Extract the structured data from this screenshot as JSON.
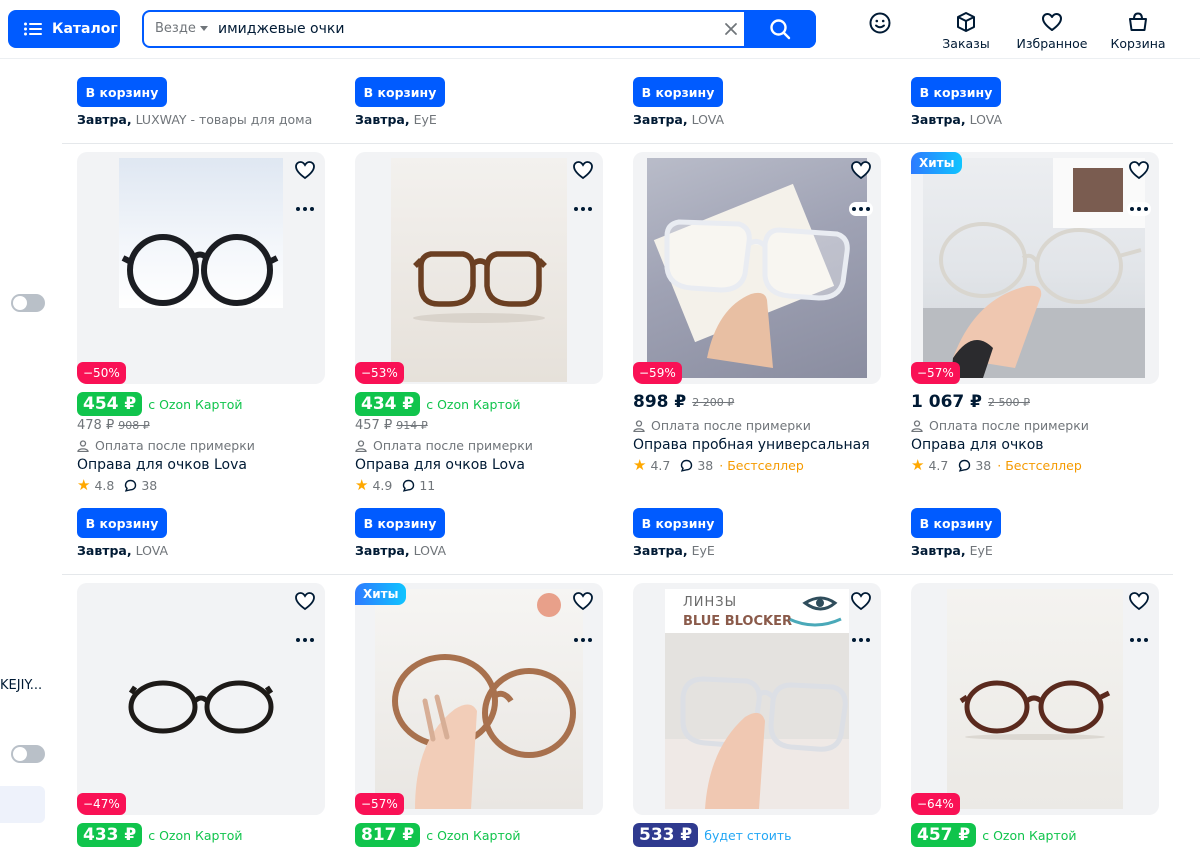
{
  "header": {
    "catalog_label": "Каталог",
    "search_scope": "Везде",
    "search_query": "имиджевые очки",
    "orders_label": "Заказы",
    "favorites_label": "Избранное",
    "cart_label": "Корзина"
  },
  "sidebar": {
    "truncated_text": "KEJIY..."
  },
  "top_row": [
    {
      "cart": "В корзину",
      "day": "Завтра,",
      "seller": "LUXWAY - товары для дома"
    },
    {
      "cart": "В корзину",
      "day": "Завтра,",
      "seller": "EyE"
    },
    {
      "cart": "В корзину",
      "day": "Завтра,",
      "seller": "LOVA"
    },
    {
      "cart": "В корзину",
      "day": "Завтра,",
      "seller": "LOVA"
    }
  ],
  "row2": [
    {
      "badge": "",
      "discount": "−50%",
      "price": "454 ₽",
      "price_note": "c Ozon Картой",
      "sub_price": "478 ₽",
      "old_price": "908 ₽",
      "pay": "Оплата после примерки",
      "title": "Оправа для очков Lova",
      "rating": "4.8",
      "reviews": "38",
      "best": "",
      "cart": "В корзину",
      "day": "Завтра,",
      "seller": "LOVA"
    },
    {
      "badge": "",
      "discount": "−53%",
      "price": "434 ₽",
      "price_note": "c Ozon Картой",
      "sub_price": "457 ₽",
      "old_price": "914 ₽",
      "pay": "Оплата после примерки",
      "title": "Оправа для очков Lova",
      "rating": "4.9",
      "reviews": "11",
      "best": "",
      "cart": "В корзину",
      "day": "Завтра,",
      "seller": "LOVA"
    },
    {
      "badge": "",
      "discount": "−59%",
      "price": "898 ₽",
      "price_note": "",
      "sub_price": "",
      "old_price": "2 200 ₽",
      "pay": "Оплата после примерки",
      "title": "Оправа пробная универсальная",
      "rating": "4.7",
      "reviews": "38",
      "best": "Бестселлер",
      "cart": "В корзину",
      "day": "Завтра,",
      "seller": "EyE"
    },
    {
      "badge": "Хиты",
      "discount": "−57%",
      "price": "1 067 ₽",
      "price_note": "",
      "sub_price": "",
      "old_price": "2 500 ₽",
      "pay": "Оплата после примерки",
      "title": "Оправа для очков",
      "rating": "4.7",
      "reviews": "38",
      "best": "Бестселлер",
      "cart": "В корзину",
      "day": "Завтра,",
      "seller": "EyE"
    }
  ],
  "row3": [
    {
      "badge": "",
      "discount": "−47%",
      "price": "433 ₽",
      "price_note": "c Ozon Картой",
      "overlay": ""
    },
    {
      "badge": "Хиты",
      "discount": "−57%",
      "price": "817 ₽",
      "price_note": "c Ozon Картой",
      "overlay": ""
    },
    {
      "badge": "",
      "discount": "",
      "price": "533 ₽",
      "price_note": "будет стоить",
      "overlay": "ЛИНЗЫ",
      "overlay2": "BLUE BLOCKER"
    },
    {
      "badge": "",
      "discount": "−64%",
      "price": "457 ₽",
      "price_note": "c Ozon Картой",
      "overlay": ""
    }
  ],
  "colors": {
    "primary": "#005bff",
    "discount": "#f91155",
    "ozon_card_price": "#10c44c",
    "bestseller": "#f59a00",
    "hits_badge": "#10c4ff"
  },
  "icons": [
    "menu-icon",
    "search-icon",
    "clear-icon",
    "smile-icon",
    "box-icon",
    "heart-icon",
    "bag-icon",
    "more-icon",
    "star-icon",
    "comment-icon",
    "user-icon"
  ]
}
